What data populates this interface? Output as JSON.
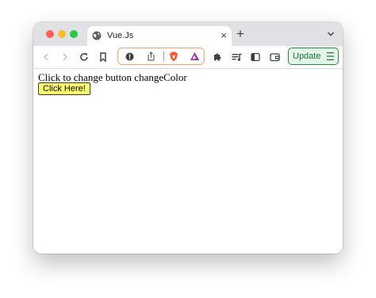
{
  "browser": {
    "tab": {
      "title": "Vue.Js",
      "icon": "globe-icon",
      "close_symbol": "×"
    },
    "new_tab_symbol": "+",
    "toolbar": {
      "icons": [
        "back-icon",
        "forward-icon",
        "reload-icon",
        "bookmark-icon",
        "site-info-icon",
        "share-icon",
        "brave-shields-icon",
        "brave-rewards-icon",
        "extensions-icon",
        "playlist-icon",
        "sidebar-icon",
        "wallet-icon"
      ],
      "update_label": "Update"
    },
    "colors": {
      "tabbar": "#dfe1e5",
      "omnibox_border": "#f0a36d",
      "update_border": "#1e8e3e",
      "update_background": "#e6f4ea"
    }
  },
  "page": {
    "text": "Click to change button changeColor",
    "button_label": "Click Here!",
    "button_color": "#ffff66"
  }
}
